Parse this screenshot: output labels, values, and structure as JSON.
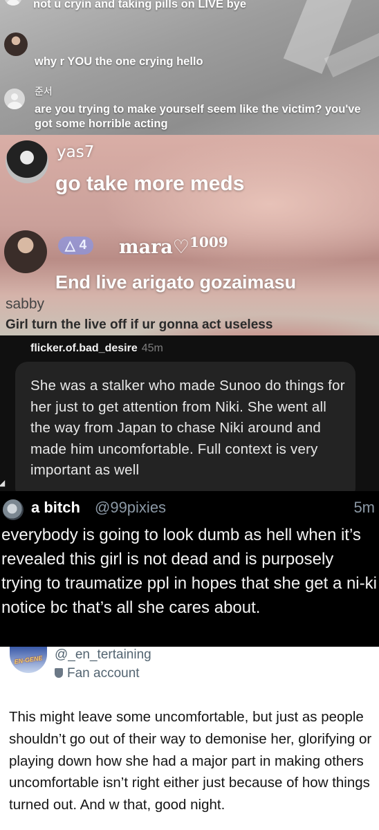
{
  "live_comments": [
    {
      "username": "",
      "text": "not u cryin and taking pills on LIVE bye"
    },
    {
      "username": "",
      "text": "why r YOU the one crying hello"
    },
    {
      "username": "준서",
      "text": "are you trying to make yourself seem like the victim? you've got some horrible acting"
    }
  ],
  "lips_live": {
    "comment1": {
      "username": "yas7",
      "text": "go take more meds"
    },
    "comment2": {
      "badge_level": "4",
      "username": "mara",
      "user_suffix": "1009",
      "text": "End live arigato gozaimasu"
    },
    "comment3": {
      "username": "sabby",
      "text": "Girl turn the live off if ur gonna act useless"
    }
  },
  "threads_reply": {
    "username": "flicker.of.bad_desire",
    "time": "45m",
    "text": "She was a stalker who made Sunoo do things for her just to get attention from Niki. She went all the way from Japan to chase Niki around and made him uncomfortable. Full context is very important as well"
  },
  "tweet": {
    "display_name": "a bitch",
    "handle": "@99pixies",
    "time": "5m",
    "text": "everybody is going to look dumb as hell when it’s revealed this girl is not dead and is purposely trying to traumatize ppl in hopes that she get a ni-ki notice bc that’s all she cares about."
  },
  "fan_post": {
    "handle": "@_en_tertaining",
    "label": "Fan account",
    "avatar_text": "EN-GENE",
    "text": "This might leave some uncomfortable, but just as people shouldn’t go out of their way to demonise her, glorifying or playing down how she had a major part in making others uncomfortable isn’t right either just because of how things turned out. And w that, good night."
  }
}
